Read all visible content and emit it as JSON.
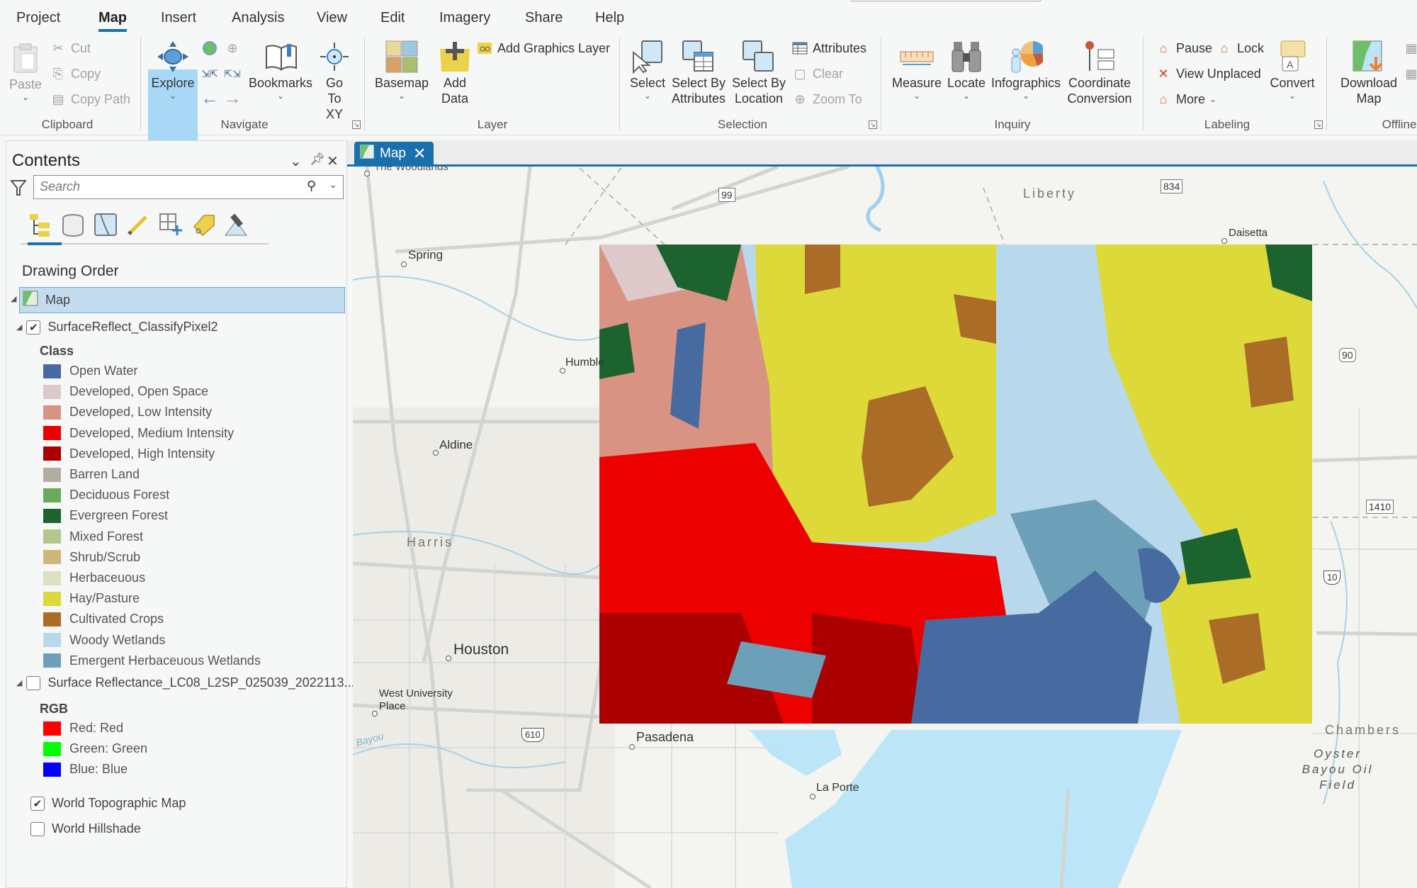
{
  "menu": {
    "tabs": [
      {
        "label": "Project"
      },
      {
        "label": "Map",
        "active": true
      },
      {
        "label": "Insert"
      },
      {
        "label": "Analysis"
      },
      {
        "label": "View"
      },
      {
        "label": "Edit"
      },
      {
        "label": "Imagery"
      },
      {
        "label": "Share"
      },
      {
        "label": "Help"
      }
    ]
  },
  "ribbon": {
    "clipboard": {
      "label": "Clipboard",
      "paste": "Paste",
      "cut": "Cut",
      "copy": "Copy",
      "copy_path": "Copy Path"
    },
    "navigate": {
      "label": "Navigate",
      "explore": "Explore",
      "bookmarks": "Bookmarks",
      "goto_xy_1": "Go",
      "goto_xy_2": "To XY"
    },
    "layer": {
      "label": "Layer",
      "basemap": "Basemap",
      "add_data_1": "Add",
      "add_data_2": "Data",
      "add_graphics_layer": "Add Graphics Layer"
    },
    "selection": {
      "label": "Selection",
      "select": "Select",
      "select_by_attr_1": "Select By",
      "select_by_attr_2": "Attributes",
      "select_by_loc_1": "Select By",
      "select_by_loc_2": "Location",
      "attributes": "Attributes",
      "clear": "Clear",
      "zoom_to": "Zoom To"
    },
    "inquiry": {
      "label": "Inquiry",
      "measure": "Measure",
      "locate": "Locate",
      "infographics": "Infographics",
      "coord_1": "Coordinate",
      "coord_2": "Conversion"
    },
    "labeling": {
      "label": "Labeling",
      "pause": "Pause",
      "lock": "Lock",
      "view_unplaced": "View Unplaced",
      "more": "More",
      "convert": "Convert"
    },
    "offline": {
      "label": "Offline",
      "download_1": "Download",
      "download_2": "Map"
    }
  },
  "contents": {
    "title": "Contents",
    "search_placeholder": "Search",
    "drawing_order": "Drawing Order",
    "map_node": "Map",
    "layers": [
      {
        "name": "SurfaceReflect_ClassifyPixel2",
        "checked": true,
        "legend_heading": "Class",
        "classes": [
          {
            "label": "Open Water",
            "color": "#476ba1"
          },
          {
            "label": "Developed, Open Space",
            "color": "#ddc9c9"
          },
          {
            "label": "Developed, Low Intensity",
            "color": "#d89382"
          },
          {
            "label": "Developed, Medium Intensity",
            "color": "#ed0000"
          },
          {
            "label": "Developed, High Intensity",
            "color": "#aa0000"
          },
          {
            "label": "Barren Land",
            "color": "#b2ada3"
          },
          {
            "label": "Deciduous Forest",
            "color": "#68ab5f"
          },
          {
            "label": "Evergreen Forest",
            "color": "#1c6330"
          },
          {
            "label": "Mixed Forest",
            "color": "#b5c58f"
          },
          {
            "label": "Shrub/Scrub",
            "color": "#ccb879"
          },
          {
            "label": "Herbaceuous",
            "color": "#dfdfc2"
          },
          {
            "label": "Hay/Pasture",
            "color": "#dcd939"
          },
          {
            "label": "Cultivated Crops",
            "color": "#ab6c28"
          },
          {
            "label": "Woody Wetlands",
            "color": "#b8d9eb"
          },
          {
            "label": "Emergent Herbaceuous Wetlands",
            "color": "#6c9fb8"
          }
        ]
      },
      {
        "name": "Surface Reflectance_LC08_L2SP_025039_2022113...",
        "checked": false,
        "legend_heading": "RGB",
        "classes": [
          {
            "label": "Red:   Red",
            "color": "#ff0000"
          },
          {
            "label": "Green: Green",
            "color": "#00ff00"
          },
          {
            "label": "Blue:  Blue",
            "color": "#0000ff"
          }
        ]
      },
      {
        "name": "World Topographic Map",
        "checked": true
      },
      {
        "name": "World Hillshade",
        "checked": false
      }
    ]
  },
  "map_tab": {
    "label": "Map"
  },
  "map_labels": {
    "places": [
      "The Woodlands",
      "Spring",
      "Humble",
      "Aldine",
      "Houston",
      "West University Place",
      "Pasadena",
      "La Porte",
      "Daisetta"
    ],
    "counties": [
      "Liberty",
      "Harris",
      "Chambers"
    ],
    "features": [
      "Oyster Bayou Oil Field",
      "Bayou"
    ],
    "shields": [
      "99",
      "834",
      "90",
      "1410",
      "10",
      "610"
    ]
  },
  "colors": {
    "accent": "#1a6fad",
    "selection": "#c4dcf0",
    "water": "#bde5f8"
  }
}
